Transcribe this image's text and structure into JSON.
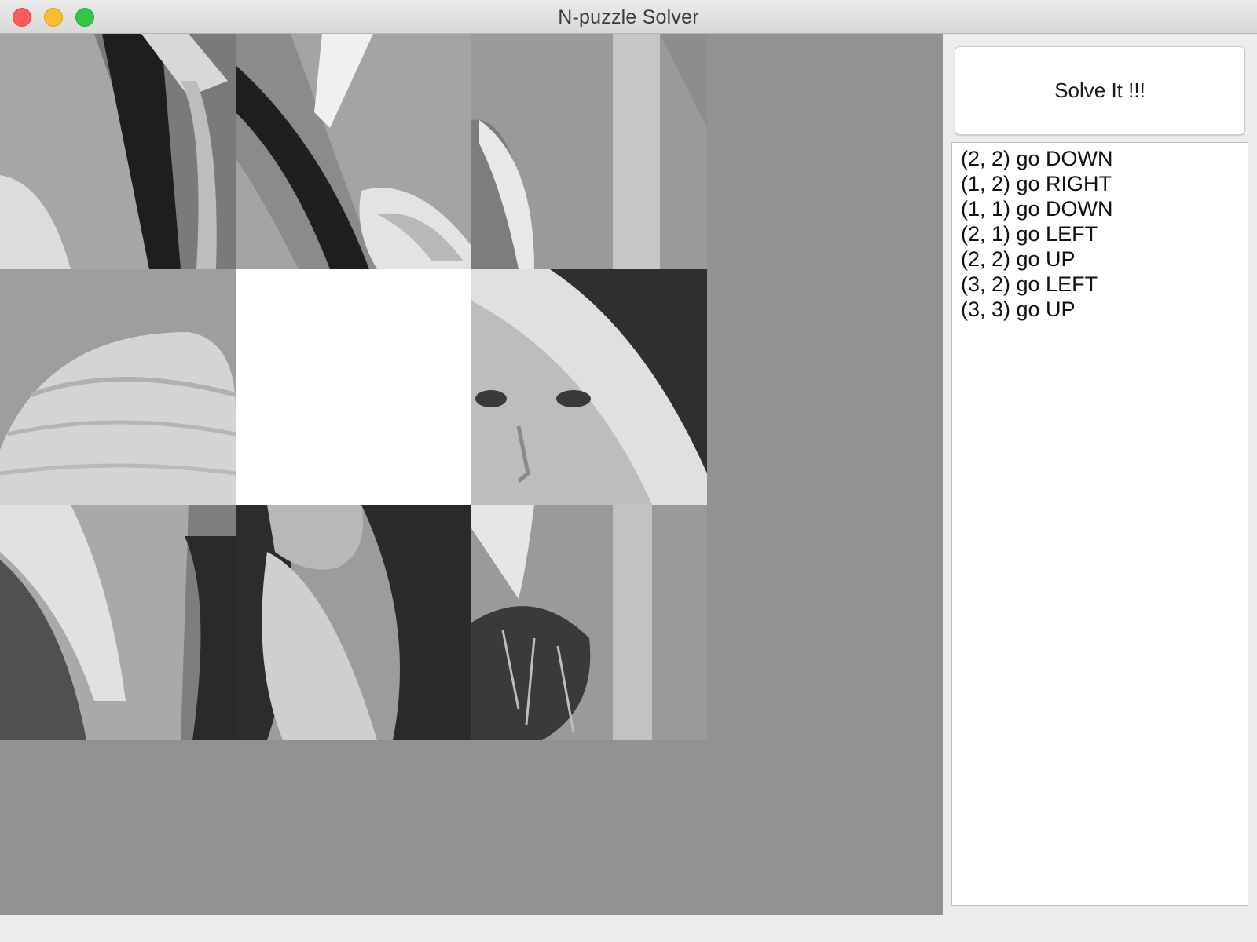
{
  "window": {
    "title": "N-puzzle Solver"
  },
  "board": {
    "size": 3,
    "empty_tile": {
      "row": 2,
      "col": 2
    }
  },
  "side_panel": {
    "solve_button_label": "Solve It !!!",
    "moves": [
      "(2, 2) go DOWN",
      "(1, 2) go RIGHT",
      "(1, 1) go DOWN",
      "(2, 1) go LEFT",
      "(2, 2) go UP",
      "(3, 2) go LEFT",
      "(3, 3) go UP"
    ]
  }
}
